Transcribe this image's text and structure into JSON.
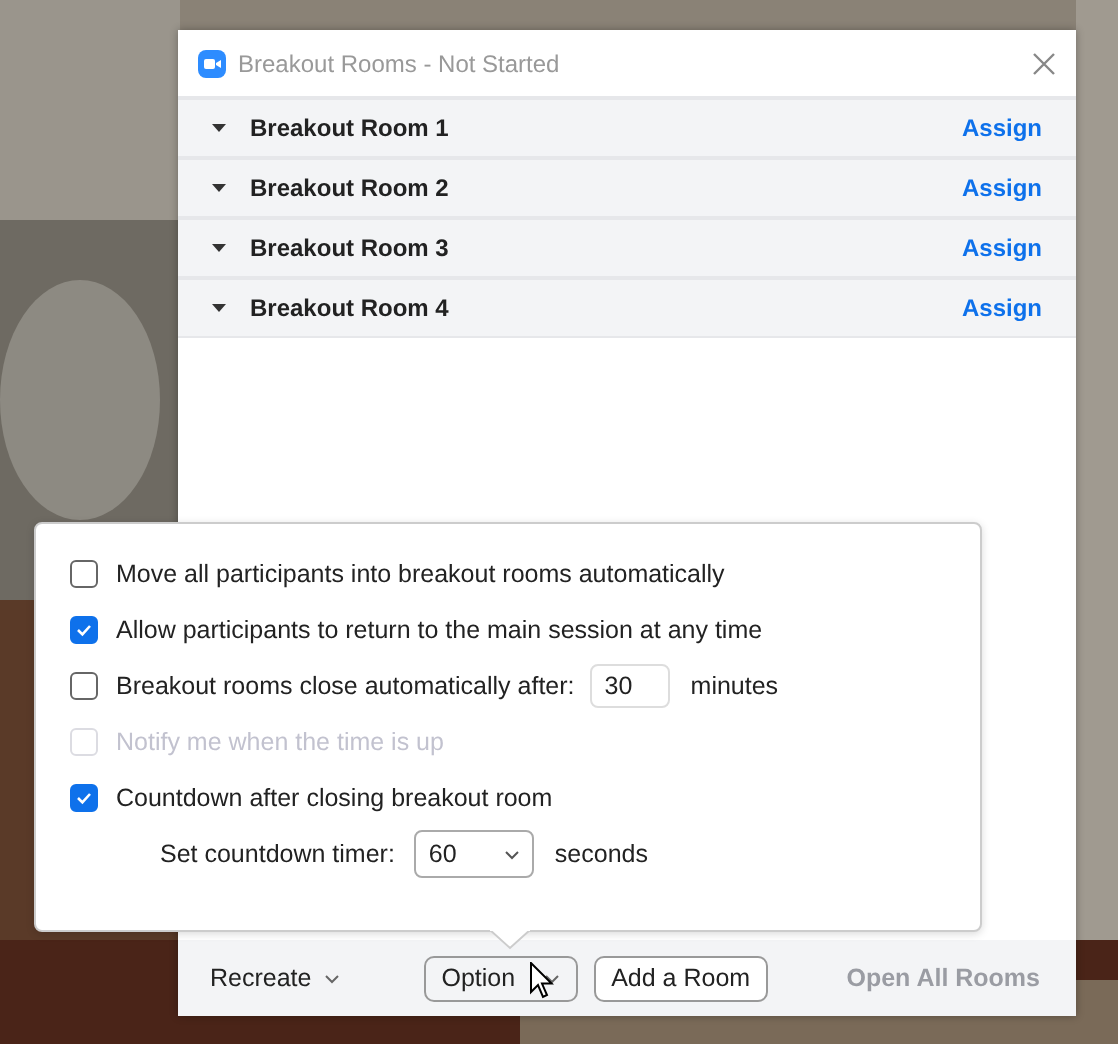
{
  "window": {
    "title": "Breakout Rooms - Not Started"
  },
  "rooms": [
    {
      "name": "Breakout Room 1",
      "action": "Assign"
    },
    {
      "name": "Breakout Room 2",
      "action": "Assign"
    },
    {
      "name": "Breakout Room 3",
      "action": "Assign"
    },
    {
      "name": "Breakout Room 4",
      "action": "Assign"
    }
  ],
  "options_popup": {
    "items": [
      {
        "kind": "checkbox",
        "label": "Move all participants into breakout rooms automatically",
        "checked": false,
        "disabled": false
      },
      {
        "kind": "checkbox",
        "label": "Allow participants to return to the main session at any time",
        "checked": true,
        "disabled": false
      },
      {
        "kind": "checkbox-input",
        "label": "Breakout rooms close automatically after:",
        "checked": false,
        "disabled": false,
        "value": "30",
        "unit": "minutes"
      },
      {
        "kind": "checkbox",
        "label": "Notify me when the time is up",
        "checked": false,
        "disabled": true
      },
      {
        "kind": "checkbox",
        "label": "Countdown after closing breakout room",
        "checked": true,
        "disabled": false
      },
      {
        "kind": "select",
        "label": "Set countdown timer:",
        "value": "60",
        "unit": "seconds"
      }
    ]
  },
  "footer": {
    "recreate": "Recreate",
    "options": "Option",
    "add_room": "Add a Room",
    "open_all": "Open All Rooms",
    "open_all_disabled": true
  }
}
